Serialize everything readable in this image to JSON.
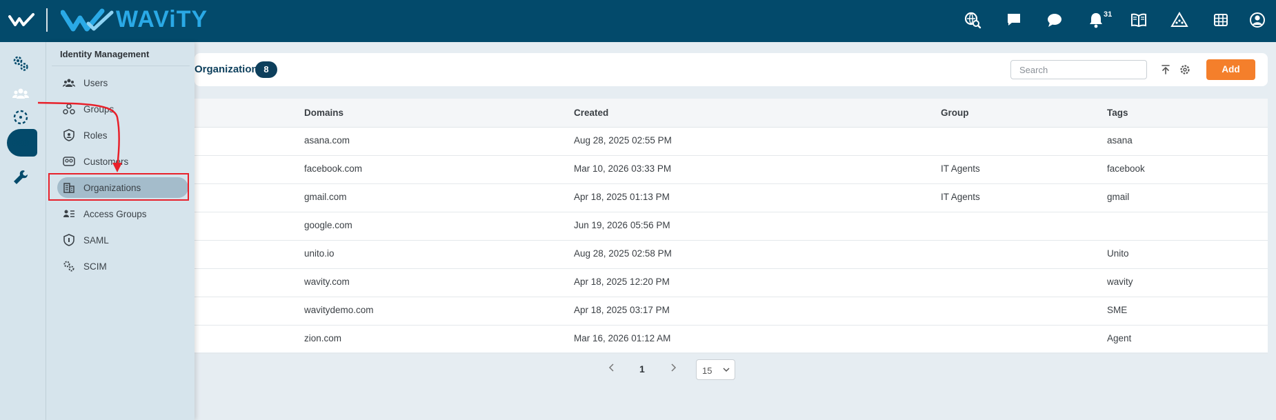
{
  "brand": {
    "name": "WAViTY"
  },
  "topbar": {
    "notification_count": "31"
  },
  "flyout": {
    "title": "Identity Management",
    "items": [
      {
        "label": "Users",
        "icon": "users-icon"
      },
      {
        "label": "Groups",
        "icon": "groups-icon"
      },
      {
        "label": "Roles",
        "icon": "roles-icon"
      },
      {
        "label": "Customers",
        "icon": "customers-icon"
      },
      {
        "label": "Organizations",
        "icon": "organizations-icon",
        "active": true
      },
      {
        "label": "Access Groups",
        "icon": "access-groups-icon"
      },
      {
        "label": "SAML",
        "icon": "saml-icon"
      },
      {
        "label": "SCIM",
        "icon": "scim-icon"
      }
    ]
  },
  "page": {
    "title": "Organizations",
    "count": "8",
    "search_placeholder": "Search",
    "add_label": "Add"
  },
  "table": {
    "columns": [
      "Domains",
      "Created",
      "Group",
      "Tags"
    ],
    "rows": [
      {
        "domain": "asana.com",
        "created": "Aug 28, 2025 02:55 PM",
        "group": "",
        "tags": "asana"
      },
      {
        "domain": "facebook.com",
        "created": "Mar 10, 2026 03:33 PM",
        "group": "IT Agents",
        "tags": "facebook"
      },
      {
        "domain": "gmail.com",
        "created": "Apr 18, 2025 01:13 PM",
        "group": "IT Agents",
        "tags": "gmail"
      },
      {
        "domain": "google.com",
        "created": "Jun 19, 2026 05:56 PM",
        "group": "",
        "tags": ""
      },
      {
        "domain": "unito.io",
        "created": "Aug 28, 2025 02:58 PM",
        "group": "",
        "tags": "Unito"
      },
      {
        "domain": "wavity.com",
        "created": "Apr 18, 2025 12:20 PM",
        "group": "",
        "tags": "wavity"
      },
      {
        "domain": "wavitydemo.com",
        "created": "Apr 18, 2025 03:17 PM",
        "group": "",
        "tags": "SME"
      },
      {
        "domain": "zion.com",
        "created": "Mar 16, 2026 01:12 AM",
        "group": "",
        "tags": "Agent"
      }
    ]
  },
  "pagination": {
    "current_page": "1",
    "page_size": "15"
  },
  "colors": {
    "topbar": "#034a6b",
    "brand": "#2aa9e6",
    "accent": "#f47f2b",
    "highlight": "#e8202a"
  }
}
